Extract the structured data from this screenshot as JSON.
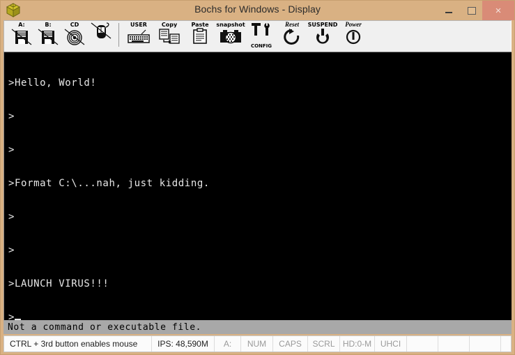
{
  "window": {
    "title": "Bochs for Windows - Display",
    "app_icon": "bochs-box-icon",
    "controls": {
      "minimize": "minimize-icon",
      "maximize": "maximize-icon",
      "close": "×"
    }
  },
  "toolbar": {
    "items": [
      {
        "label": "A:",
        "icon": "floppy-a-icon",
        "sublabel": ""
      },
      {
        "label": "B:",
        "icon": "floppy-b-icon",
        "sublabel": ""
      },
      {
        "label": "CD",
        "icon": "cdrom-icon",
        "sublabel": ""
      },
      {
        "label": "",
        "icon": "mouse-disabled-icon",
        "sublabel": ""
      },
      {
        "label": "USER",
        "icon": "keyboard-icon",
        "sublabel": ""
      },
      {
        "label": "Copy",
        "icon": "copy-icon",
        "sublabel": ""
      },
      {
        "label": "Paste",
        "icon": "paste-icon",
        "sublabel": ""
      },
      {
        "label": "snapshot",
        "icon": "camera-icon",
        "sublabel": ""
      },
      {
        "label": "",
        "icon": "tools-icon",
        "sublabel": "CONFIG"
      },
      {
        "label": "Reset",
        "icon": "reset-arrow-icon",
        "sublabel": ""
      },
      {
        "label": "SUSPEND",
        "icon": "suspend-icon",
        "sublabel": ""
      },
      {
        "label": "Power",
        "icon": "power-icon",
        "sublabel": ""
      }
    ]
  },
  "terminal": {
    "lines": [
      ">Hello, World!",
      ">",
      ">",
      ">Format C:\\...nah, just kidding.",
      ">",
      ">",
      ">LAUNCH VIRUS!!!"
    ],
    "prompt": ">",
    "background": "#000000",
    "foreground": "#e8e8e8"
  },
  "message_bar": {
    "text": "Not a command or executable file.",
    "background": "#a8a8a8"
  },
  "status_bar": {
    "hint": "CTRL + 3rd button enables mouse",
    "ips": "IPS: 48,590M",
    "indicators": [
      "A:",
      "NUM",
      "CAPS",
      "SCRL",
      "HD:0-M",
      "UHCI"
    ],
    "empty_cells": 4
  },
  "colors": {
    "titlebar": "#d9b183",
    "close_button": "#d98b77",
    "toolbar": "#f0f0f0",
    "statusbar": "#fbfbfb"
  }
}
